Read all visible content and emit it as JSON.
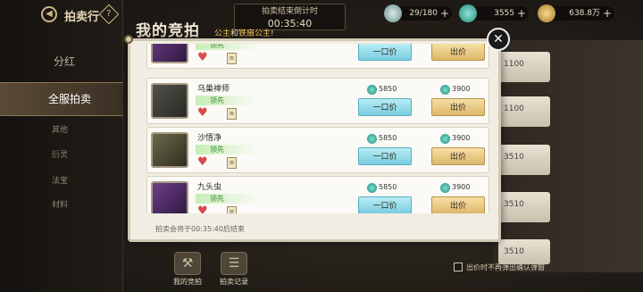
{
  "sidebar": {
    "title": "拍卖行",
    "items": [
      {
        "label": "分红"
      },
      {
        "label": "全服拍卖"
      }
    ],
    "subitems": [
      {
        "label": "其他"
      },
      {
        "label": "衍灵"
      },
      {
        "label": "法宝"
      },
      {
        "label": "材料"
      }
    ]
  },
  "timer": {
    "label": "拍卖结束倒计时",
    "value": "00:35:40"
  },
  "resources": [
    {
      "value": "29/180",
      "icon": "jade-icon"
    },
    {
      "value": "3555",
      "icon": "coin-icon"
    },
    {
      "value": "638.8万",
      "icon": "gold-ingot-icon"
    }
  ],
  "panel": {
    "title": "我的竞拍",
    "notice_prefix": "公主",
    "notice_mid": "和",
    "notice_name": "铁扇公主",
    "notice_suffix": "!"
  },
  "bids": [
    {
      "name": "",
      "status": "领先",
      "buyout": "",
      "bid": "",
      "buy_label": "一口价",
      "bid_label": "出价"
    },
    {
      "name": "乌巢禅师",
      "status": "领先",
      "buyout": "5850",
      "bid": "3900",
      "buy_label": "一口价",
      "bid_label": "出价"
    },
    {
      "name": "沙悟净",
      "status": "领先",
      "buyout": "5850",
      "bid": "3900",
      "buy_label": "一口价",
      "bid_label": "出价"
    },
    {
      "name": "九头虫",
      "status": "领先",
      "buyout": "5850",
      "bid": "3900",
      "buy_label": "一口价",
      "bid_label": "出价"
    }
  ],
  "end_text": "拍卖会将于00:35:40后结束",
  "right_values": [
    "1100",
    "1100",
    "3510",
    "3510",
    "3510"
  ],
  "bottom_nav": [
    {
      "label": "我的竞拍"
    },
    {
      "label": "拍卖记录"
    }
  ],
  "checkbox_label": "出价时不再弹出确认弹窗"
}
